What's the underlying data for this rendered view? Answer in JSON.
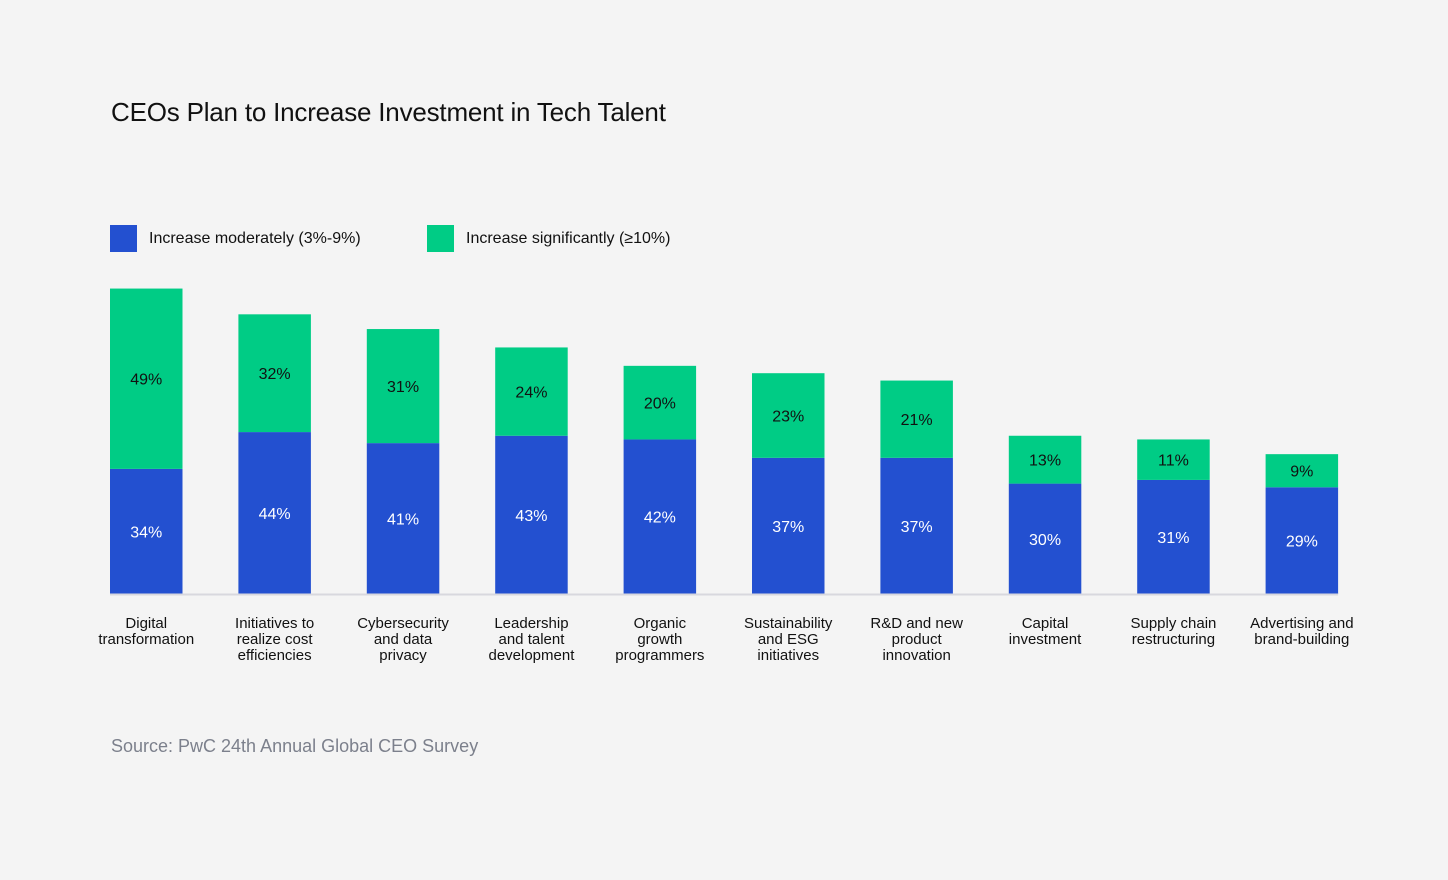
{
  "chart_data": {
    "type": "bar",
    "stacked": true,
    "title": "CEOs Plan to Increase Investment in Tech Talent",
    "xlabel": "",
    "ylabel": "",
    "ylim": [
      0,
      85
    ],
    "grid": false,
    "legend_position": "top-left",
    "categories": [
      [
        "Digital",
        "transformation"
      ],
      [
        "Initiatives to",
        "realize cost",
        "efficiencies"
      ],
      [
        "Cybersecurity",
        "and data",
        "privacy"
      ],
      [
        "Leadership",
        "and talent",
        "development"
      ],
      [
        "Organic",
        "growth",
        "programmers"
      ],
      [
        "Sustainability",
        "and ESG",
        "initiatives"
      ],
      [
        "R&D and new",
        "product",
        "innovation"
      ],
      [
        "Capital",
        "investment"
      ],
      [
        "Supply chain",
        "restructuring"
      ],
      [
        "Advertising and",
        "brand-building"
      ]
    ],
    "series": [
      {
        "name": "Increase moderately (3%-9%)",
        "color": "#2350d0",
        "label_color": "#ffffff",
        "values": [
          34,
          44,
          41,
          43,
          42,
          37,
          37,
          30,
          31,
          29
        ]
      },
      {
        "name": "Increase significantly (≥10%)",
        "color": "#00cc85",
        "label_color": "#111111",
        "values": [
          49,
          32,
          31,
          24,
          20,
          23,
          21,
          13,
          11,
          9
        ]
      }
    ],
    "value_suffix": "%",
    "source": "Source: PwC 24th Annual Global CEO Survey"
  }
}
